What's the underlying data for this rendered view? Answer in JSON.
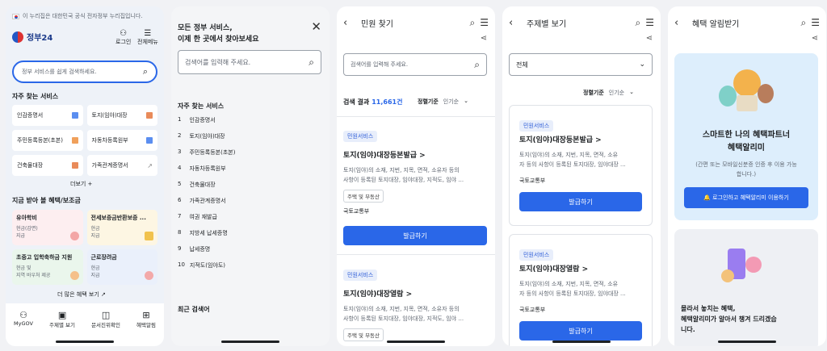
{
  "home": {
    "banner": "이 누리집은 대한민국 공식 전자정부 누리집입니다.",
    "logo": "정부24",
    "login": "로그인",
    "menu": "전체메뉴",
    "search_placeholder": "정부 서비스를 쉽게 검색하세요.",
    "freq_title": "자주 찾는 서비스",
    "services": [
      "인감증명서",
      "토지(임야)대장",
      "주민등록등본(초본)",
      "자동차등록원부",
      "건축물대장",
      "가족관계증명서"
    ],
    "more": "더보기 +",
    "benefit_title": "지금 받아 볼 혜택/보조금",
    "benefits": [
      {
        "title": "유아학비",
        "sub1": "현금(감면)",
        "sub2": "지급"
      },
      {
        "title": "전세보증금반환보증 ...",
        "sub1": "현금",
        "sub2": "지급"
      },
      {
        "title": "초중고 입학축하금 지원",
        "sub1": "현금 및",
        "sub2": "지역 바우처 제공"
      },
      {
        "title": "근로장려금",
        "sub1": "현금",
        "sub2": "지급"
      }
    ],
    "more_benefit": "더 많은 혜택 보기 ↗",
    "nav": [
      "MyGOV",
      "주제별 보기",
      "문서진위확인",
      "혜택알림"
    ]
  },
  "search": {
    "title_line1": "모든 정부 서비스,",
    "title_line2": "이제 한 곳에서 찾아보세요",
    "placeholder": "검색어를 입력해 주세요.",
    "freq_title": "자주 찾는 서비스",
    "items": [
      "인감증명서",
      "토지(임야)대장",
      "주민등록등본(초본)",
      "자동차등록원부",
      "건축물대장",
      "가족관계증명서",
      "여권 재발급",
      "지방세 납세증명",
      "납세증명",
      "지적도(임야도)"
    ],
    "recent_title": "최근 검색어"
  },
  "civil": {
    "title": "민원 찾기",
    "placeholder": "검색어를 입력해 주세요.",
    "result_label": "검색 결과",
    "result_count": "11,661건",
    "sort_label": "정렬기준",
    "sort_value": "인기순",
    "chip": "민원서비스",
    "card1": {
      "title": "토지(임야)대장등본발급 >",
      "desc1": "토지(임야)의 소재, 지번, 지목, 면적, 소유자 등의",
      "desc2": "사항이 등록된 토지대장, 임야대장, 지적도, 임야 ...",
      "tag": "주택 및 부동산",
      "agency": "국토교통부",
      "btn": "발급하기"
    },
    "card2": {
      "title": "토지(임야)대장열람 >",
      "desc1": "토지(임야)의 소재, 지번, 지목, 면적, 소유자 등의",
      "desc2": "사항이 등록된 토지대장, 임야대장, 지적도, 임야 ...",
      "tag": "주택 및 부동산"
    }
  },
  "topic": {
    "title": "주제별 보기",
    "select": "전체",
    "sort_label": "정렬기준",
    "sort_value": "인기순",
    "chip": "민원서비스",
    "card1": {
      "title": "토지(임야)대장등본발급 >",
      "desc1": "토지(임야)의 소재, 지번, 지목, 면적, 소유",
      "desc2": "자 등의 사항이 등록된 토지대장, 임야대장 ...",
      "agency": "국토교통부",
      "btn": "발급하기"
    },
    "card2": {
      "title": "토지(임야)대장열람 >",
      "desc1": "토지(임야)의 소재, 지번, 지목, 면적, 소유",
      "desc2": "자 등의 사항이 등록된 토지대장, 임야대장 ...",
      "agency": "국토교통부",
      "btn": "발급하기"
    }
  },
  "alert": {
    "title": "혜택 알림받기",
    "head1": "스마트한 나의 혜택파트너",
    "head2": "혜택알리미",
    "note1": "(간편 또는 모바일신분증 인증 후 이용 가능",
    "note2": "합니다.)",
    "btn": "🔔 로그인하고 혜택알리미 이용하기",
    "bottom1": "몰라서 놓치는 혜택,",
    "bottom2": "혜택알리미가 알아서 챙겨 드리겠습",
    "bottom3": "니다."
  }
}
